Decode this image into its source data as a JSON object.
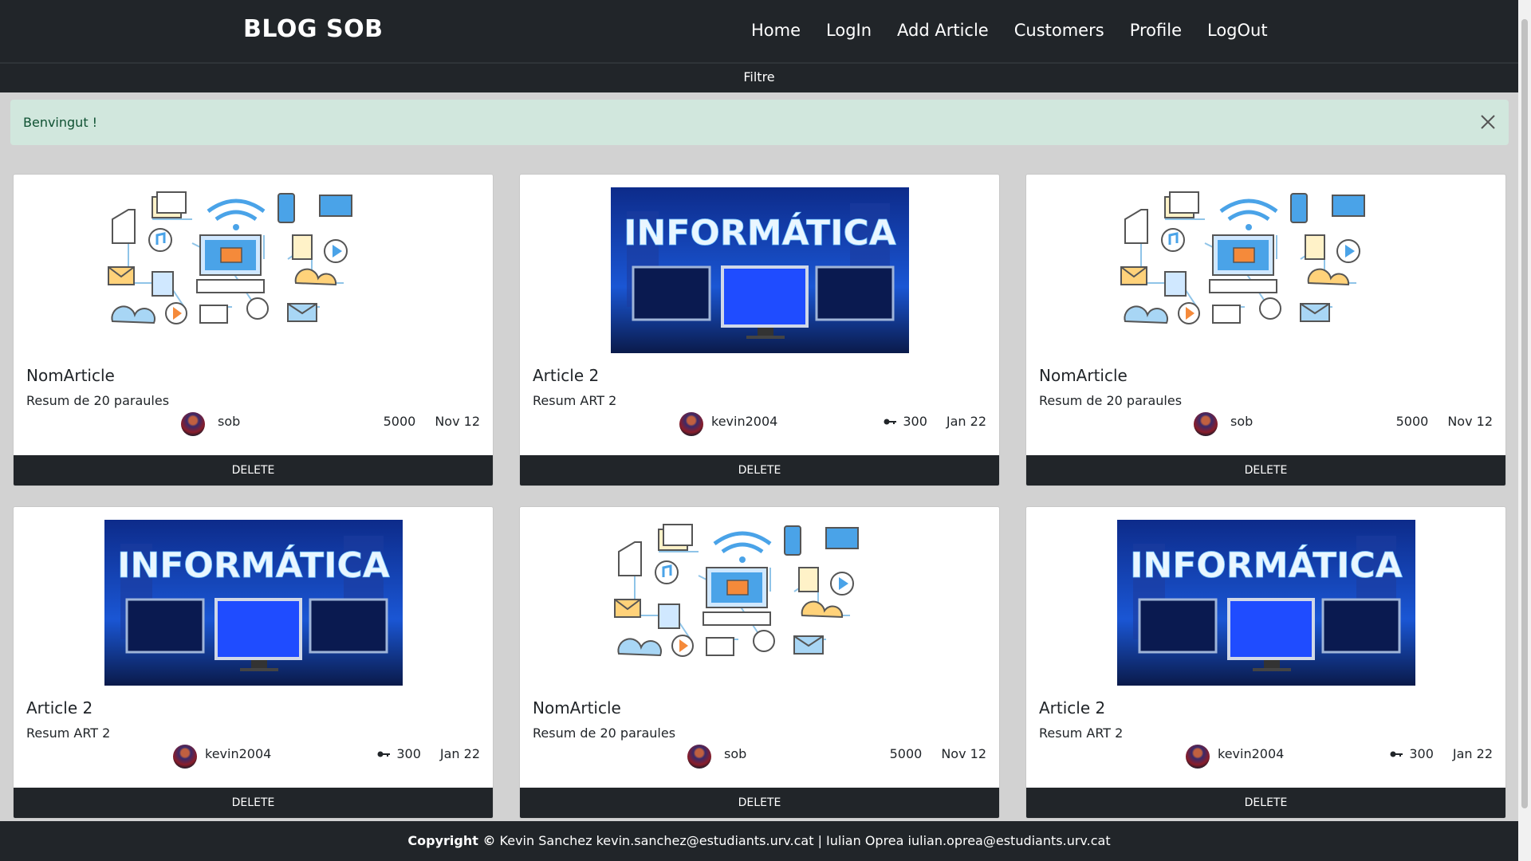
{
  "header": {
    "brand": "BLOG SOB",
    "nav": [
      "Home",
      "LogIn",
      "Add Article",
      "Customers",
      "Profile",
      "LogOut"
    ],
    "filter_label": "Filtre"
  },
  "alert": {
    "message": "Benvingut !"
  },
  "cards": [
    {
      "image": "network-illustration",
      "title": "NomArticle",
      "summary": "Resum de 20 paraules",
      "author": "sob",
      "views": "5000",
      "date": "Nov 12",
      "delete_label": "DELETE",
      "has_key": false
    },
    {
      "image": "informatica-banner",
      "title": "Article 2",
      "summary": "Resum ART 2",
      "author": "kevin2004",
      "views": "300",
      "date": "Jan 22",
      "delete_label": "DELETE",
      "has_key": true
    },
    {
      "image": "network-illustration",
      "title": "NomArticle",
      "summary": "Resum de 20 paraules",
      "author": "sob",
      "views": "5000",
      "date": "Nov 12",
      "delete_label": "DELETE",
      "has_key": false
    },
    {
      "image": "informatica-banner",
      "title": "Article 2",
      "summary": "Resum ART 2",
      "author": "kevin2004",
      "views": "300",
      "date": "Jan 22",
      "delete_label": "DELETE",
      "has_key": true
    },
    {
      "image": "network-illustration",
      "title": "NomArticle",
      "summary": "Resum de 20 paraules",
      "author": "sob",
      "views": "5000",
      "date": "Nov 12",
      "delete_label": "DELETE",
      "has_key": false
    },
    {
      "image": "informatica-banner",
      "title": "Article 2",
      "summary": "Resum ART 2",
      "author": "kevin2004",
      "views": "300",
      "date": "Jan 22",
      "delete_label": "DELETE",
      "has_key": true
    }
  ],
  "banner_text": "INFORMÁTICA",
  "footer": {
    "copyright_label": "Copyright ©",
    "credits": "Kevin Sanchez kevin.sanchez@estudiants.urv.cat | Iulian Oprea iulian.oprea@estudiants.urv.cat"
  },
  "colors": {
    "dark": "#212529",
    "alert_bg": "#d1e7dd",
    "alert_text": "#0f5132",
    "page_bg": "#d2d2d2"
  }
}
